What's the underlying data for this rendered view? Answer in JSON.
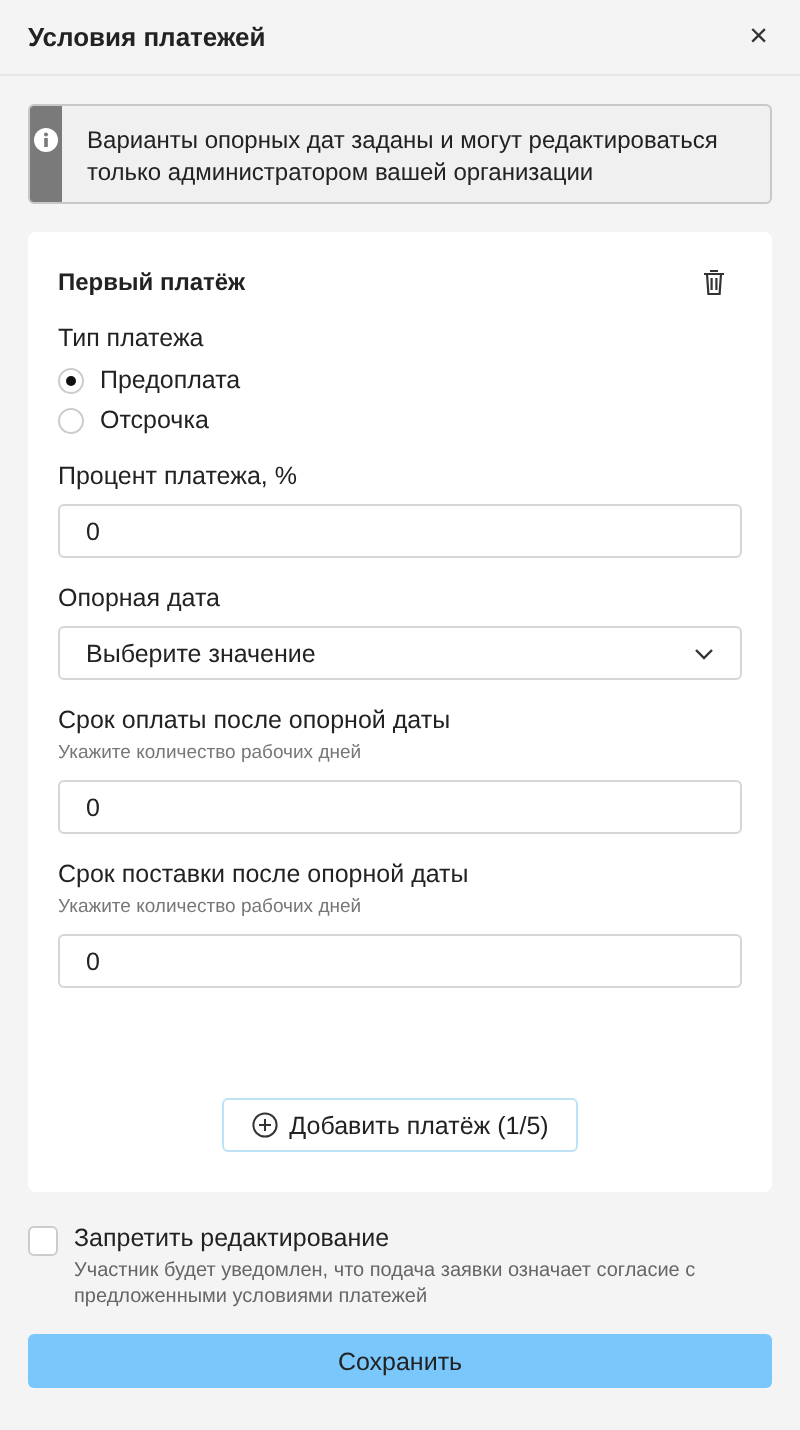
{
  "window": {
    "title": "Условия платежей",
    "close": "×"
  },
  "notice": {
    "text": "Варианты опорных дат заданы и могут редактироваться только администратором вашей организации"
  },
  "payment": {
    "title": "Первый платёж",
    "type_label": "Тип платежа",
    "options": [
      {
        "label": "Предоплата",
        "selected": true
      },
      {
        "label": "Отсрочка",
        "selected": false
      }
    ],
    "fields": [
      {
        "kind": "input",
        "label": "Процент платежа, %",
        "value": "0"
      },
      {
        "kind": "select",
        "label": "Опорная дата",
        "value": "Выберите значение"
      },
      {
        "kind": "input",
        "label": "Срок оплаты после опорной даты",
        "hint": "Укажите количество рабочих дней",
        "value": "0"
      },
      {
        "kind": "input",
        "label": "Срок поставки после опорной даты",
        "hint": "Укажите количество рабочих дней",
        "value": "0"
      }
    ],
    "add_button": "Добавить платёж (1/5)"
  },
  "lock": {
    "label": "Запретить редактирование",
    "checked": false,
    "description": "Участник будет уведомлен, что подача заявки означает согласие с предложенными условиями платежей"
  },
  "save_button": "Сохранить"
}
